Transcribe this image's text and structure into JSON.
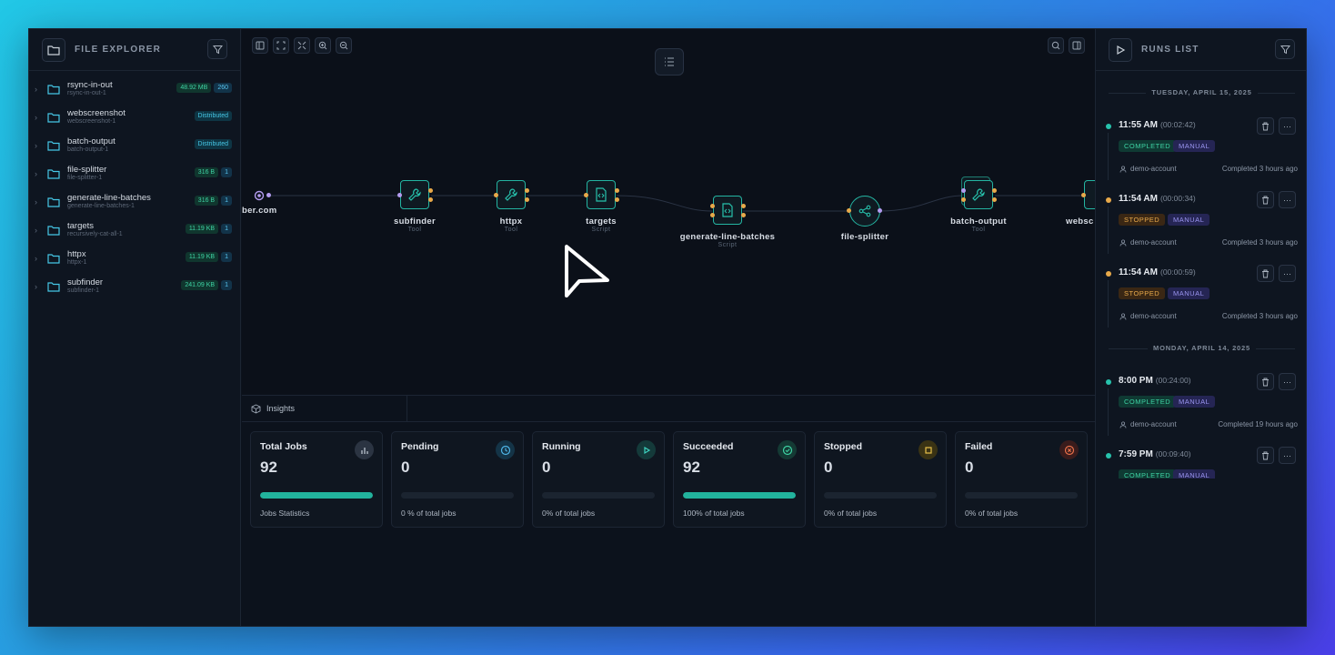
{
  "file_explorer": {
    "title": "FILE EXPLORER",
    "items": [
      {
        "name": "rsync-in-out",
        "sub": "rsync-in-out-1",
        "badges": [
          {
            "text": "48.92 MB",
            "kind": "green"
          },
          {
            "text": "260",
            "kind": "num"
          }
        ]
      },
      {
        "name": "webscreenshot",
        "sub": "webscreenshot-1",
        "badges": [
          {
            "text": "Distributed",
            "kind": "cyan"
          }
        ]
      },
      {
        "name": "batch-output",
        "sub": "batch-output-1",
        "badges": [
          {
            "text": "Distributed",
            "kind": "cyan"
          }
        ]
      },
      {
        "name": "file-splitter",
        "sub": "file-splitter-1",
        "badges": [
          {
            "text": "316 B",
            "kind": "green"
          },
          {
            "text": "1",
            "kind": "num"
          }
        ]
      },
      {
        "name": "generate-line-batches",
        "sub": "generate-line-batches-1",
        "badges": [
          {
            "text": "316 B",
            "kind": "green"
          },
          {
            "text": "1",
            "kind": "num"
          }
        ]
      },
      {
        "name": "targets",
        "sub": "recursively-cat-all-1",
        "badges": [
          {
            "text": "11.19 KB",
            "kind": "green"
          },
          {
            "text": "1",
            "kind": "num"
          }
        ]
      },
      {
        "name": "httpx",
        "sub": "httpx-1",
        "badges": [
          {
            "text": "11.19 KB",
            "kind": "green"
          },
          {
            "text": "1",
            "kind": "num"
          }
        ]
      },
      {
        "name": "subfinder",
        "sub": "subfinder-1",
        "badges": [
          {
            "text": "241.09 KB",
            "kind": "green"
          },
          {
            "text": "1",
            "kind": "num"
          }
        ]
      }
    ]
  },
  "workflow": {
    "input_label": "ber.com",
    "nodes": [
      {
        "name": "subfinder",
        "type": "Tool"
      },
      {
        "name": "httpx",
        "type": "Tool"
      },
      {
        "name": "targets",
        "type": "Script"
      },
      {
        "name": "generate-line-batches",
        "type": "Script"
      },
      {
        "name": "file-splitter",
        "type": ""
      },
      {
        "name": "batch-output",
        "type": "Tool"
      },
      {
        "name": "websc",
        "type": ""
      }
    ]
  },
  "insights": {
    "tab_label": "Insights",
    "cards": [
      {
        "title": "Total Jobs",
        "value": "92",
        "progress": 1.0,
        "footer": "Jobs Statistics",
        "icon": "bar-chart-icon"
      },
      {
        "title": "Pending",
        "value": "0",
        "progress": 0,
        "footer": "0 % of total jobs",
        "icon": "clock-icon"
      },
      {
        "title": "Running",
        "value": "0",
        "progress": 0,
        "footer": "0% of total jobs",
        "icon": "play-icon"
      },
      {
        "title": "Succeeded",
        "value": "92",
        "progress": 1.0,
        "footer": "100% of total jobs",
        "icon": "check-circle-icon"
      },
      {
        "title": "Stopped",
        "value": "0",
        "progress": 0,
        "footer": "0% of total jobs",
        "icon": "stop-icon"
      },
      {
        "title": "Failed",
        "value": "0",
        "progress": 0,
        "footer": "0% of total jobs",
        "icon": "x-circle-icon"
      }
    ]
  },
  "runs": {
    "title": "RUNS LIST",
    "groups": [
      {
        "date": "TUESDAY, APRIL 15, 2025"
      },
      {
        "date": "MONDAY, APRIL 14, 2025"
      }
    ],
    "items": [
      {
        "time": "11:55 AM",
        "duration": "(00:02:42)",
        "status": "COMPLETED",
        "trigger": "MANUAL",
        "account": "demo-account",
        "completed": "Completed 3 hours ago"
      },
      {
        "time": "11:54 AM",
        "duration": "(00:00:34)",
        "status": "STOPPED",
        "trigger": "MANUAL",
        "account": "demo-account",
        "completed": "Completed 3 hours ago"
      },
      {
        "time": "11:54 AM",
        "duration": "(00:00:59)",
        "status": "STOPPED",
        "trigger": "MANUAL",
        "account": "demo-account",
        "completed": "Completed 3 hours ago"
      },
      {
        "time": "8:00 PM",
        "duration": "(00:24:00)",
        "status": "COMPLETED",
        "trigger": "MANUAL",
        "account": "demo-account",
        "completed": "Completed 19 hours ago"
      },
      {
        "time": "7:59 PM",
        "duration": "(00:09:40)",
        "status": "COMPLETED",
        "trigger": "MANUAL",
        "account": "",
        "completed": ""
      }
    ]
  },
  "colors": {
    "accent": "#22b39d",
    "completed": "#3ed3a4",
    "stopped": "#e8a94a",
    "manual": "#9a95f0"
  }
}
